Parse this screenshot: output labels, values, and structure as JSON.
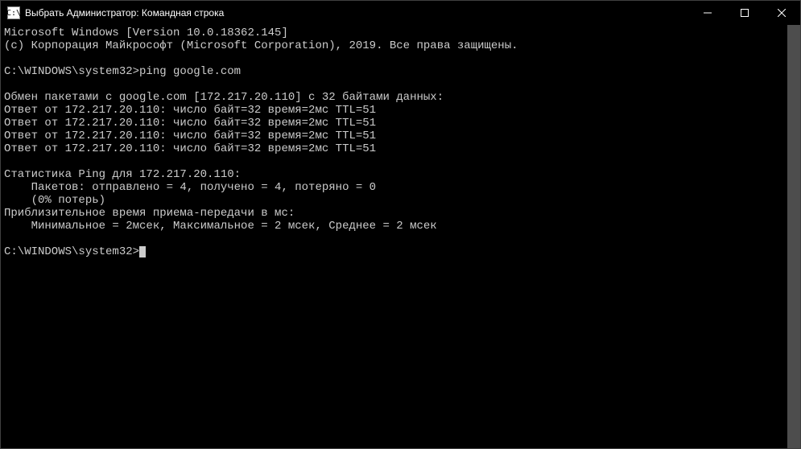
{
  "titlebar": {
    "icon_text": "C:\\",
    "title": "Выбрать Администратор: Командная строка"
  },
  "terminal": {
    "lines": [
      "Microsoft Windows [Version 10.0.18362.145]",
      "(c) Корпорация Майкрософт (Microsoft Corporation), 2019. Все права защищены.",
      "",
      "C:\\WINDOWS\\system32>ping google.com",
      "",
      "Обмен пакетами с google.com [172.217.20.110] с 32 байтами данных:",
      "Ответ от 172.217.20.110: число байт=32 время=2мс TTL=51",
      "Ответ от 172.217.20.110: число байт=32 время=2мс TTL=51",
      "Ответ от 172.217.20.110: число байт=32 время=2мс TTL=51",
      "Ответ от 172.217.20.110: число байт=32 время=2мс TTL=51",
      "",
      "Статистика Ping для 172.217.20.110:",
      "    Пакетов: отправлено = 4, получено = 4, потеряно = 0",
      "    (0% потерь)",
      "Приблизительное время приема-передачи в мс:",
      "    Минимальное = 2мсек, Максимальное = 2 мсек, Среднее = 2 мсек",
      ""
    ],
    "prompt": "C:\\WINDOWS\\system32>"
  }
}
